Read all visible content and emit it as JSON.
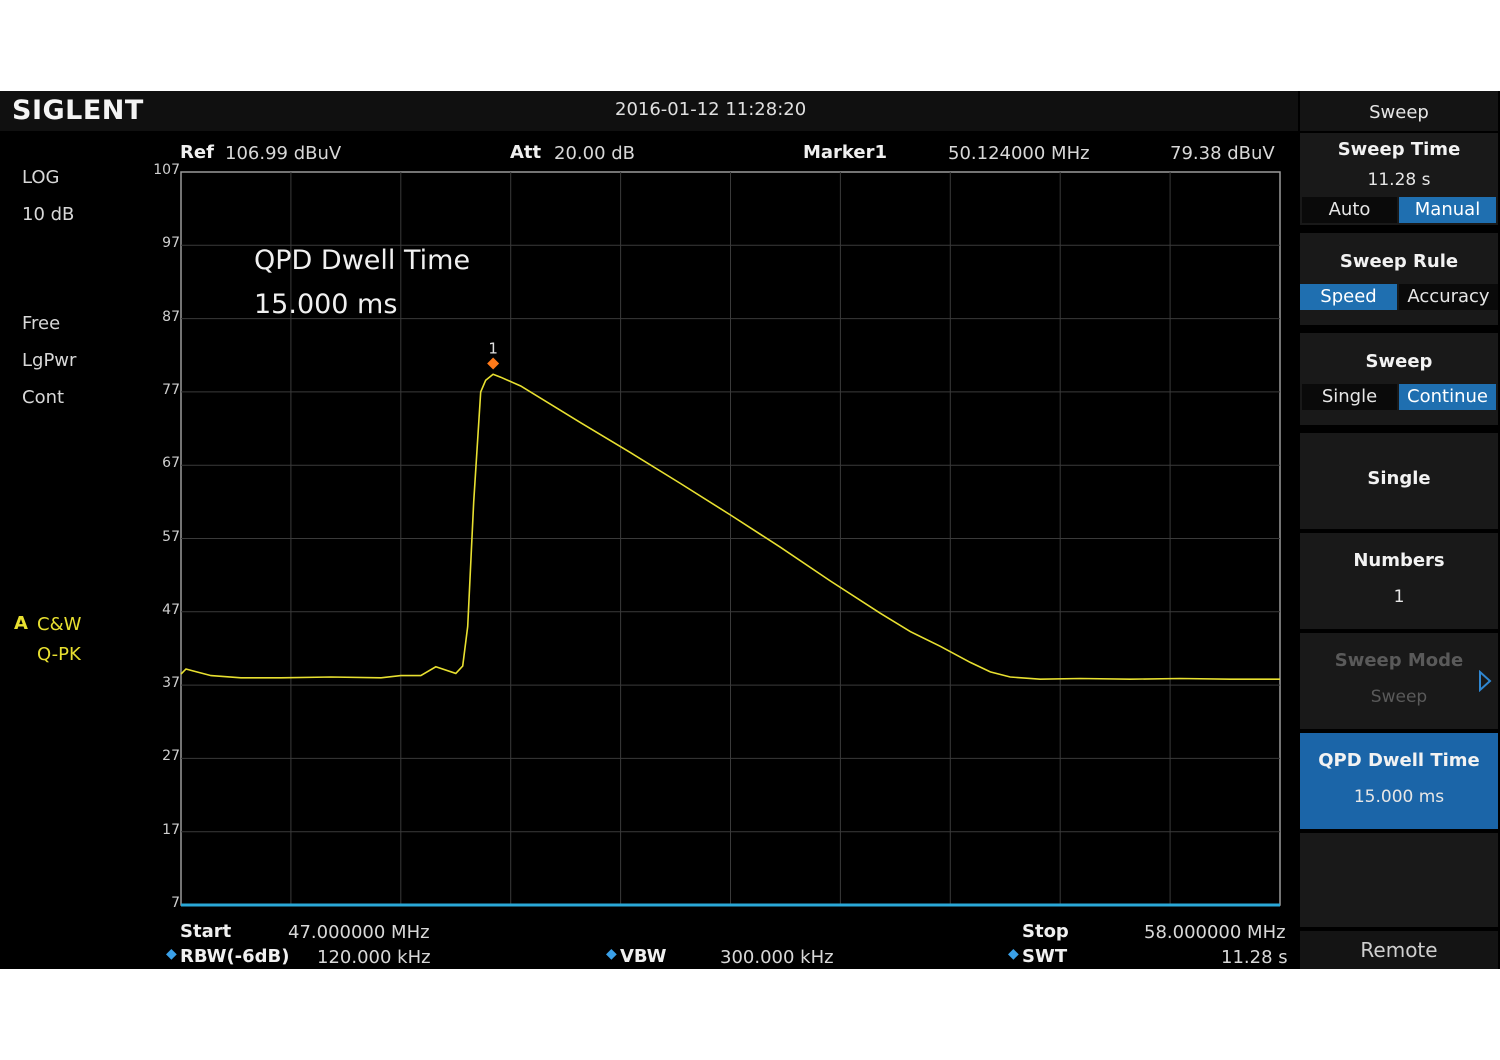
{
  "brand": "SIGLENT",
  "datetime": "2016-01-12   11:28:20",
  "header": {
    "ref_label": "Ref",
    "ref_value": "106.99 dBuV",
    "att_label": "Att",
    "att_value": "20.00 dB",
    "marker_label": "Marker1",
    "marker_freq": "50.124000 MHz",
    "marker_level": "79.38 dBuV"
  },
  "left_info": {
    "scale_type": "LOG",
    "scale_div": "10 dB",
    "trigger": "Free",
    "detector": "LgPwr",
    "sweep_mode": "Cont",
    "trace_letter": "A",
    "trace_mode": "C&W",
    "trace_detector": "Q-PK"
  },
  "annotation": {
    "line1": "QPD Dwell Time",
    "line2": "15.000 ms"
  },
  "marker_number": "1",
  "footer": {
    "start_label": "Start",
    "start_value": "47.000000 MHz",
    "stop_label": "Stop",
    "stop_value": "58.000000 MHz",
    "rbw_label": "RBW(-6dB)",
    "rbw_value": "120.000 kHz",
    "vbw_label": "VBW",
    "vbw_value": "300.000 kHz",
    "swt_label": "SWT",
    "swt_value": "11.28 s"
  },
  "menu": {
    "title": "Sweep",
    "sweep_time": {
      "label": "Sweep Time",
      "value": "11.28 s",
      "opt_a": "Auto",
      "opt_b": "Manual",
      "selected": "Manual"
    },
    "sweep_rule": {
      "label": "Sweep Rule",
      "opt_a": "Speed",
      "opt_b": "Accuracy",
      "selected": "Speed"
    },
    "sweep": {
      "label": "Sweep",
      "opt_a": "Single",
      "opt_b": "Continue",
      "selected": "Continue"
    },
    "single": {
      "label": "Single"
    },
    "numbers": {
      "label": "Numbers",
      "value": "1"
    },
    "sweep_mode": {
      "label": "Sweep Mode",
      "value": "Sweep",
      "disabled": true
    },
    "qpd_dwell": {
      "label": "QPD Dwell Time",
      "value": "15.000 ms",
      "active": true
    },
    "remote": "Remote"
  },
  "colors": {
    "trace": "#e8e030",
    "marker": "#ff7a1a",
    "grid": "#3a3a3a",
    "accent": "#1f6fb0"
  },
  "chart_data": {
    "type": "line",
    "x_unit": "MHz",
    "y_unit": "dBuV",
    "xlim": [
      47.0,
      58.0
    ],
    "ylim": [
      7,
      107
    ],
    "y_ticks": [
      107,
      97,
      87,
      77,
      67,
      57,
      47,
      37,
      27,
      17,
      7
    ],
    "grid": true,
    "series": [
      {
        "x": [
          47.0,
          47.05,
          47.1,
          47.3,
          47.6,
          48.0,
          48.5,
          49.0,
          49.2,
          49.4,
          49.55,
          49.75,
          49.82,
          49.87,
          49.93,
          50.0,
          50.05,
          50.124,
          50.2,
          50.4,
          51.0,
          51.5,
          52.0,
          52.5,
          53.0,
          53.5,
          54.0,
          54.3,
          54.6,
          54.9,
          55.1,
          55.3,
          55.6,
          56.0,
          56.5,
          57.0,
          57.5,
          58.0
        ],
        "y": [
          38.5,
          39.2,
          39.0,
          38.3,
          38.0,
          38.0,
          38.1,
          38.0,
          38.3,
          38.3,
          39.5,
          38.6,
          39.6,
          45,
          62,
          77,
          78.6,
          79.4,
          79.0,
          77.8,
          72.8,
          68.7,
          64.5,
          60.2,
          55.8,
          51.2,
          46.8,
          44.3,
          42.3,
          40.1,
          38.8,
          38.1,
          37.8,
          37.9,
          37.8,
          37.9,
          37.8,
          37.8
        ]
      }
    ],
    "markers": [
      {
        "label": "1",
        "x": 50.124,
        "y": 79.38
      }
    ]
  }
}
